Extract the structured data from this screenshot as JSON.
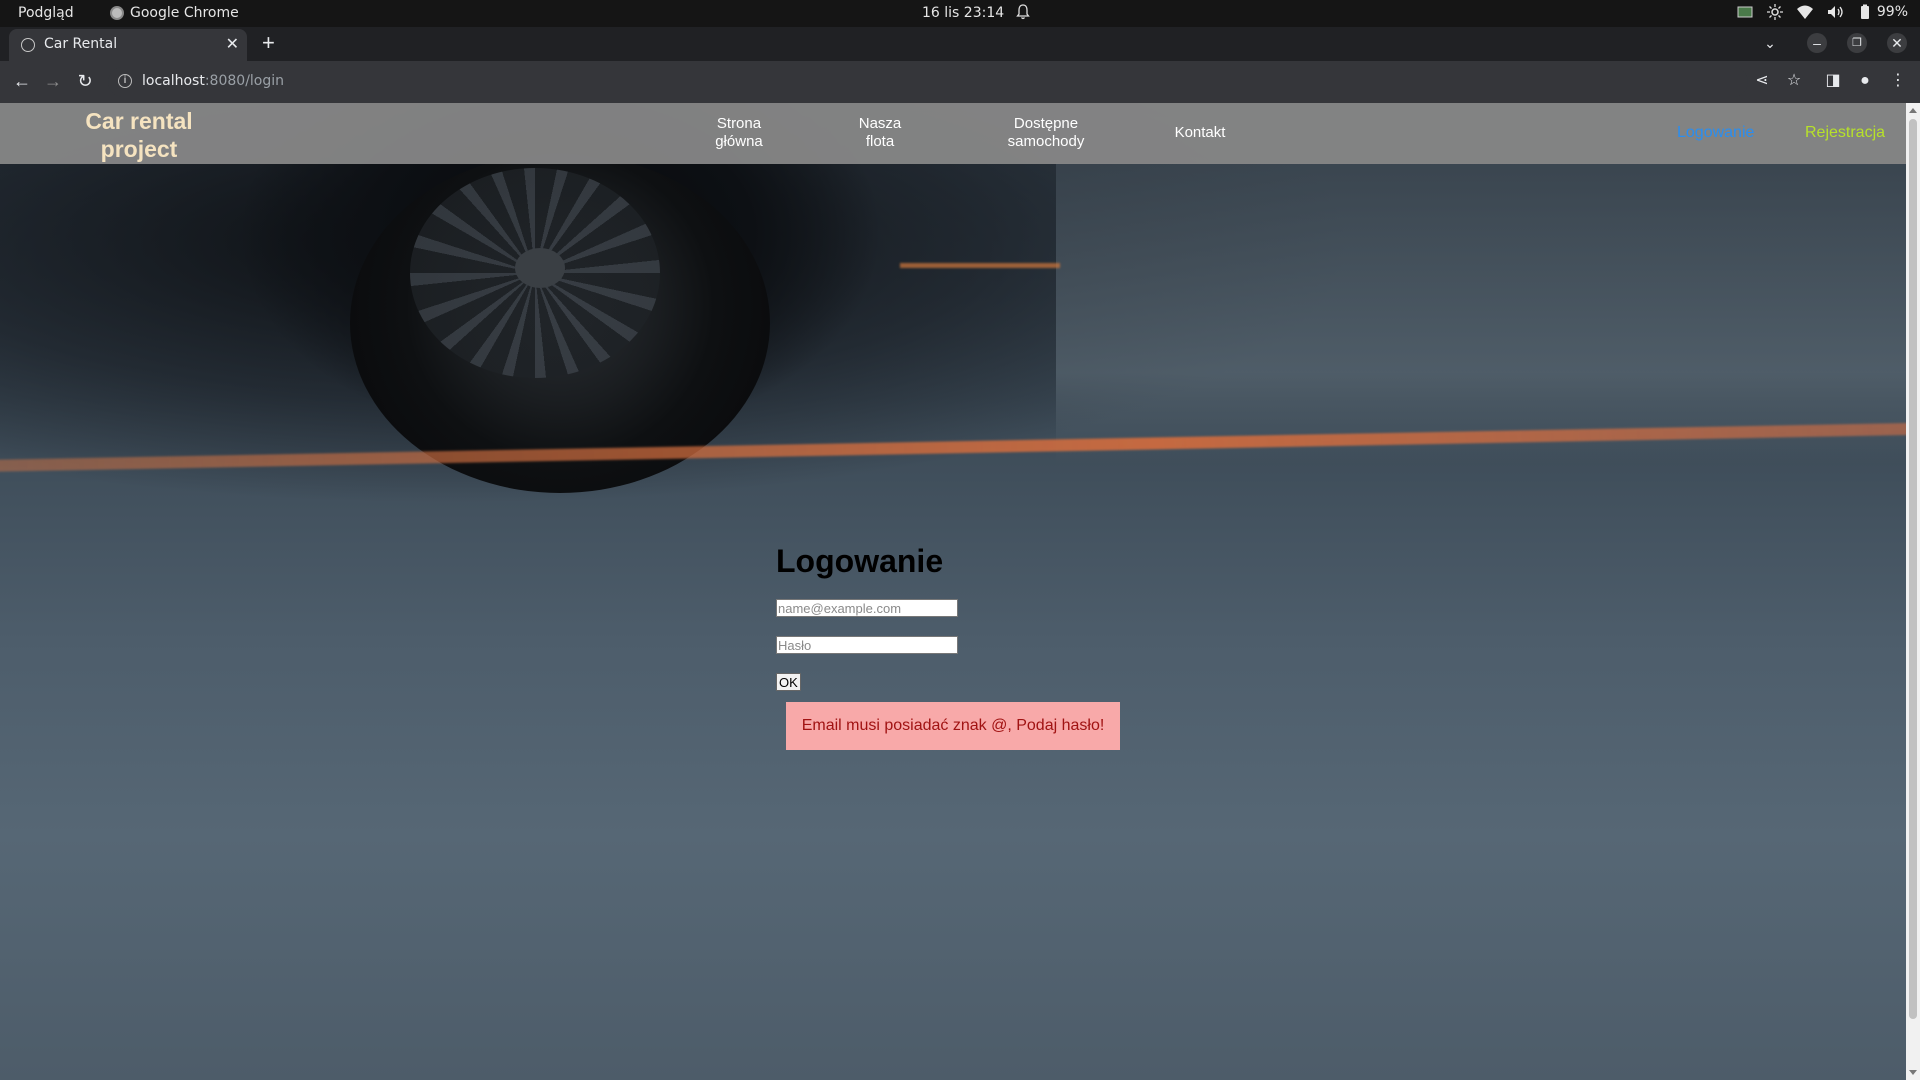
{
  "os": {
    "activities": "Podgląd",
    "app_name": "Google Chrome",
    "clock": "16 lis  23:14",
    "battery": "99%"
  },
  "browser": {
    "tab_title": "Car Rental",
    "url_host": "localhost",
    "url_path": ":8080/login"
  },
  "site": {
    "brand": "Car rental\nproject",
    "menu": [
      {
        "label": "Strona\ngłówna"
      },
      {
        "label": "Nasza\nflota"
      },
      {
        "label": "Dostępne\nsamochody"
      },
      {
        "label": "Kontakt"
      }
    ],
    "login_link": "Logowanie",
    "register_link": "Rejestracja",
    "colors": {
      "login_link": "#2a8ef0",
      "register_link": "#b7e12a",
      "brand": "#f5e3c0",
      "alert_bg": "#f8a9a9",
      "alert_text": "#a11313"
    }
  },
  "login_form": {
    "title": "Logowanie",
    "email_placeholder": "name@example.com",
    "password_placeholder": "Hasło",
    "submit_label": "OK",
    "error_message": "Email musi posiadać znak @, Podaj hasło!"
  }
}
